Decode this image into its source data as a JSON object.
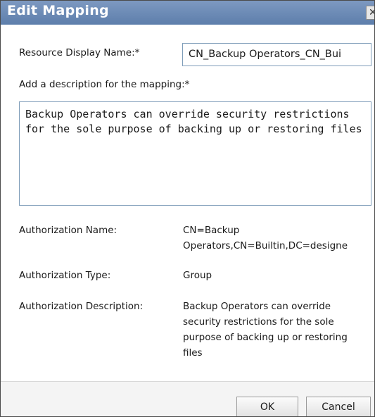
{
  "dialog": {
    "title": "Edit Mapping",
    "close_icon": "close-icon",
    "close_glyph": "✕"
  },
  "form": {
    "resource_display_name_label": "Resource Display Name:*",
    "resource_display_name_value": "CN_Backup Operators_CN_Bui",
    "description_label": "Add a description for the mapping:*",
    "description_value": "Backup Operators can override security restrictions\nfor the sole purpose of backing up or restoring files"
  },
  "details": {
    "authorization_name_label": "Authorization Name:",
    "authorization_name_line1": "CN=Backup",
    "authorization_name_line2": "Operators,CN=Builtin,DC=designe",
    "authorization_type_label": "Authorization Type:",
    "authorization_type_value": "Group",
    "authorization_description_label": "Authorization Description:",
    "authorization_description_value": "Backup Operators can override security restrictions for the sole purpose of backing up or restoring files"
  },
  "footer": {
    "ok_label": "OK",
    "cancel_label": "Cancel"
  },
  "colors": {
    "titlebar": "#6a88b4",
    "input_border": "#7f9db9",
    "footer_bg": "#f4f4f4"
  }
}
